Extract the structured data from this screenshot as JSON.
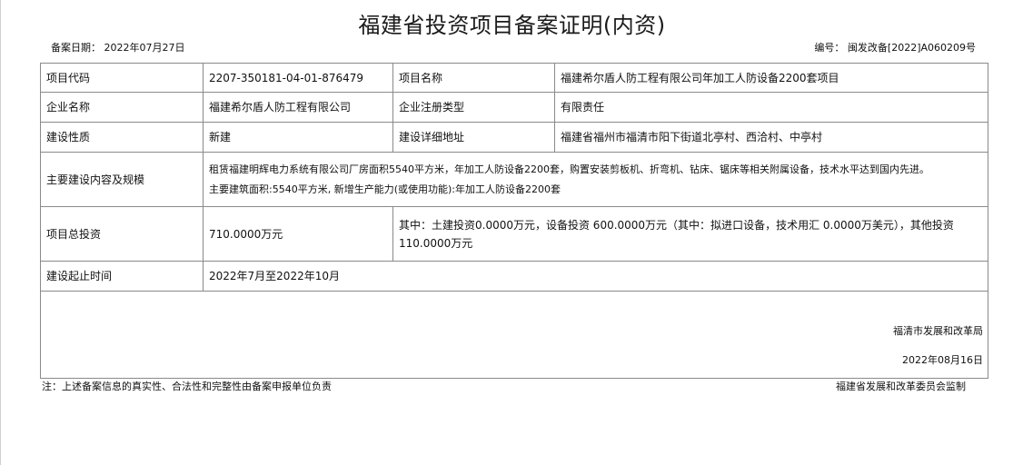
{
  "document": {
    "title": "福建省投资项目备案证明(内资)",
    "filing_date_label": "备案日期：",
    "filing_date": "2022年07月27日",
    "number_label": "编号：",
    "number": "闽发改备[2022]A060209号"
  },
  "table": {
    "project_code_label": "项目代码",
    "project_code": "2207-350181-04-01-876479",
    "project_name_label": "项目名称",
    "project_name": "福建希尔盾人防工程有限公司年加工人防设备2200套项目",
    "company_name_label": "企业名称",
    "company_name": "福建希尔盾人防工程有限公司",
    "company_type_label": "企业注册类型",
    "company_type": "有限责任",
    "nature_label": "建设性质",
    "nature": "新建",
    "address_label": "建设详细地址",
    "address": "福建省福州市福清市阳下街道北亭村、西洽村、中亭村",
    "scope_label": "主要建设内容及规模",
    "scope_line1": "租赁福建明辉电力系统有限公司厂房面积5540平方米，年加工人防设备2200套，购置安装剪板机、折弯机、钻床、锯床等相关附属设备，技术水平达到国内先进。",
    "scope_line2": "主要建筑面积:5540平方米, 新增生产能力(或使用功能):年加工人防设备2200套",
    "total_investment_label": "项目总投资",
    "total_investment": "710.0000万元",
    "investment_detail_line1": "其中：土建投资0.0000万元，设备投资 600.0000万元（其中：拟进口设备，技术用汇 0.0000万美元），其他投资",
    "investment_detail_line2": "110.0000万元",
    "period_label": "建设起止时间",
    "period": "2022年7月至2022年10月",
    "issuer": "福清市发展和改革局",
    "issue_date": "2022年08月16日"
  },
  "footer": {
    "note": "注：上述备案信息的真实性、合法性和完整性由备案申报单位负责",
    "supervisor": "福建省发展和改革委员会监制"
  }
}
